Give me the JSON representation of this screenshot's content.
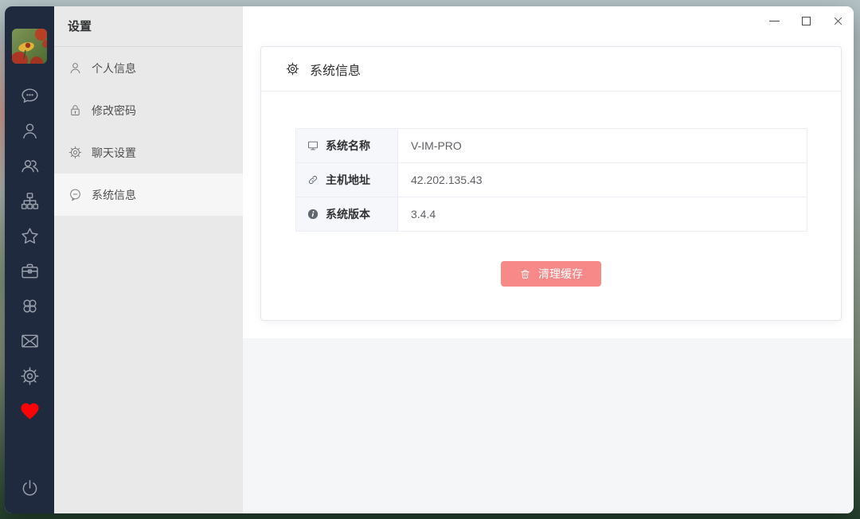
{
  "window": {
    "controls": [
      {
        "name": "minimize"
      },
      {
        "name": "maximize"
      },
      {
        "name": "close"
      }
    ]
  },
  "rail": {
    "icons": [
      "avatar",
      "chat",
      "user",
      "users",
      "org-tree",
      "star",
      "briefcase",
      "apps",
      "mail",
      "gear",
      "heart",
      "power"
    ],
    "heart_color": "#fb0307"
  },
  "sidebar": {
    "title": "设置",
    "items": [
      {
        "icon": "user-icon",
        "label": "个人信息",
        "selected": false
      },
      {
        "icon": "lock-icon",
        "label": "修改密码",
        "selected": false
      },
      {
        "icon": "gear-icon",
        "label": "聊天设置",
        "selected": false
      },
      {
        "icon": "comment-icon",
        "label": "系统信息",
        "selected": true
      }
    ]
  },
  "card": {
    "icon": "gear-icon",
    "title": "系统信息",
    "rows": [
      {
        "icon": "monitor-icon",
        "label": "系统名称",
        "value": "V-IM-PRO"
      },
      {
        "icon": "link-icon",
        "label": "主机地址",
        "value": "42.202.135.43"
      },
      {
        "icon": "info-icon",
        "label": "系统版本",
        "value": "3.4.4"
      }
    ],
    "clear_cache_button": {
      "icon": "trash-icon",
      "label": "清理缓存",
      "color": "#f78989"
    }
  },
  "colors": {
    "rail_bg": "#202a3e",
    "sidebar_bg": "#e9e9e9",
    "selected_item_bg": "#f6f6f6",
    "card_border": "#e4e7ed",
    "table_label_bg": "#f5f7fa",
    "danger": "#f78989",
    "heart": "#fb0307"
  }
}
